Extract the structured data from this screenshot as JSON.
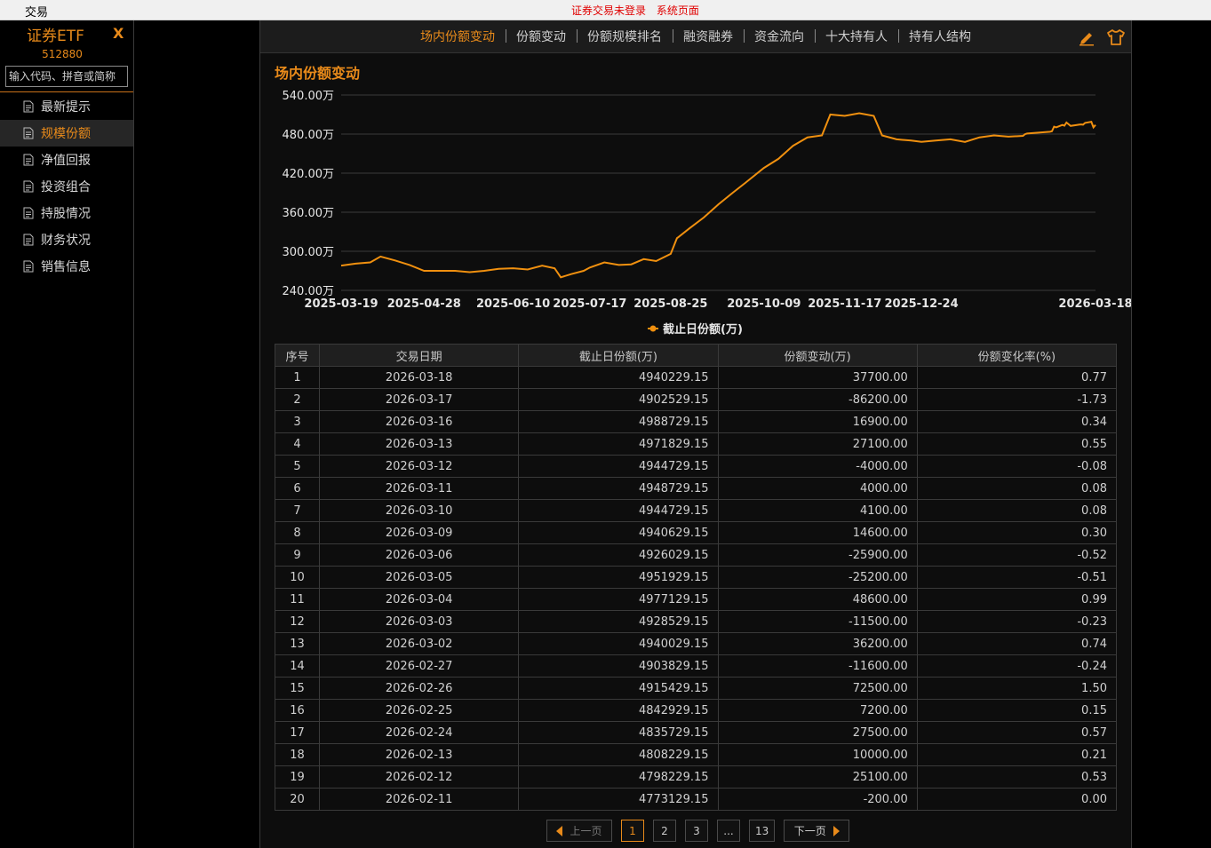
{
  "topbar": {
    "menu": "交易",
    "notice_login": "证券交易未登录",
    "notice_system": "系统页面"
  },
  "sidebar": {
    "title": "证券ETF",
    "close": "X",
    "code": "512880",
    "search_placeholder": "输入代码、拼音或简称",
    "items": [
      {
        "label": "最新提示"
      },
      {
        "label": "规模份额"
      },
      {
        "label": "净值回报"
      },
      {
        "label": "投资组合"
      },
      {
        "label": "持股情况"
      },
      {
        "label": "财务状况"
      },
      {
        "label": "销售信息"
      }
    ],
    "active_index": 1
  },
  "tabs": [
    "场内份额变动",
    "份额变动",
    "份额规模排名",
    "融资融券",
    "资金流向",
    "十大持有人",
    "持有人结构"
  ],
  "active_tab": 0,
  "section_title": "场内份额变动",
  "colors": {
    "accent": "#e88a1a",
    "up": "#ff3b3b",
    "down": "#2fae3d",
    "line": "#f0900f"
  },
  "chart_data": {
    "type": "line",
    "title": "",
    "legend": "截止日份额(万)",
    "legend_position": "bottom",
    "ylim": [
      240,
      540
    ],
    "yticks": [
      "540.00万",
      "480.00万",
      "420.00万",
      "360.00万",
      "300.00万",
      "240.00万"
    ],
    "xticks": [
      "2025-03-19",
      "2025-04-28",
      "2025-06-10",
      "2025-07-17",
      "2025-08-25",
      "2025-10-09",
      "2025-11-17",
      "2025-12-24",
      "2026-03-18"
    ],
    "grid": true,
    "series": [
      {
        "name": "截止日份额(万)",
        "points": [
          [
            "2025-03-19",
            278
          ],
          [
            "2025-03-26",
            281
          ],
          [
            "2025-04-02",
            283
          ],
          [
            "2025-04-07",
            292
          ],
          [
            "2025-04-14",
            286
          ],
          [
            "2025-04-21",
            279
          ],
          [
            "2025-04-28",
            270
          ],
          [
            "2025-05-06",
            270
          ],
          [
            "2025-05-13",
            270
          ],
          [
            "2025-05-20",
            268
          ],
          [
            "2025-05-27",
            270
          ],
          [
            "2025-06-03",
            273
          ],
          [
            "2025-06-10",
            274
          ],
          [
            "2025-06-17",
            272
          ],
          [
            "2025-06-24",
            278
          ],
          [
            "2025-06-30",
            274
          ],
          [
            "2025-07-03",
            260
          ],
          [
            "2025-07-08",
            265
          ],
          [
            "2025-07-14",
            270
          ],
          [
            "2025-07-17",
            275
          ],
          [
            "2025-07-24",
            283
          ],
          [
            "2025-07-31",
            279
          ],
          [
            "2025-08-06",
            280
          ],
          [
            "2025-08-12",
            288
          ],
          [
            "2025-08-18",
            285
          ],
          [
            "2025-08-25",
            296
          ],
          [
            "2025-08-28",
            320
          ],
          [
            "2025-09-03",
            335
          ],
          [
            "2025-09-10",
            352
          ],
          [
            "2025-09-17",
            372
          ],
          [
            "2025-09-24",
            390
          ],
          [
            "2025-09-30",
            405
          ],
          [
            "2025-10-09",
            428
          ],
          [
            "2025-10-16",
            442
          ],
          [
            "2025-10-23",
            462
          ],
          [
            "2025-10-30",
            475
          ],
          [
            "2025-11-06",
            478
          ],
          [
            "2025-11-10",
            510
          ],
          [
            "2025-11-17",
            508
          ],
          [
            "2025-11-24",
            512
          ],
          [
            "2025-12-01",
            508
          ],
          [
            "2025-12-05",
            478
          ],
          [
            "2025-12-12",
            472
          ],
          [
            "2025-12-19",
            470
          ],
          [
            "2025-12-24",
            468
          ],
          [
            "2025-12-31",
            470
          ],
          [
            "2026-01-07",
            472
          ],
          [
            "2026-01-14",
            468
          ],
          [
            "2026-01-21",
            475
          ],
          [
            "2026-01-28",
            478
          ],
          [
            "2026-02-04",
            476
          ],
          [
            "2026-02-11",
            477.3
          ],
          [
            "2026-02-12",
            479.8
          ],
          [
            "2026-02-13",
            480.8
          ],
          [
            "2026-02-24",
            483.6
          ],
          [
            "2026-02-25",
            484.3
          ],
          [
            "2026-02-26",
            491.5
          ],
          [
            "2026-02-27",
            490.4
          ],
          [
            "2026-03-02",
            494.0
          ],
          [
            "2026-03-03",
            492.9
          ],
          [
            "2026-03-04",
            497.7
          ],
          [
            "2026-03-05",
            495.2
          ],
          [
            "2026-03-06",
            492.6
          ],
          [
            "2026-03-09",
            494.1
          ],
          [
            "2026-03-10",
            494.5
          ],
          [
            "2026-03-11",
            494.9
          ],
          [
            "2026-03-12",
            494.5
          ],
          [
            "2026-03-13",
            497.2
          ],
          [
            "2026-03-16",
            498.9
          ],
          [
            "2026-03-17",
            490.3
          ],
          [
            "2026-03-18",
            494.0
          ]
        ]
      }
    ]
  },
  "table": {
    "headers": [
      "序号",
      "交易日期",
      "截止日份额(万)",
      "份额变动(万)",
      "份额变化率(%)"
    ],
    "rows": [
      [
        "1",
        "2026-03-18",
        "4940229.15",
        "37700.00",
        "0.77"
      ],
      [
        "2",
        "2026-03-17",
        "4902529.15",
        "-86200.00",
        "-1.73"
      ],
      [
        "3",
        "2026-03-16",
        "4988729.15",
        "16900.00",
        "0.34"
      ],
      [
        "4",
        "2026-03-13",
        "4971829.15",
        "27100.00",
        "0.55"
      ],
      [
        "5",
        "2026-03-12",
        "4944729.15",
        "-4000.00",
        "-0.08"
      ],
      [
        "6",
        "2026-03-11",
        "4948729.15",
        "4000.00",
        "0.08"
      ],
      [
        "7",
        "2026-03-10",
        "4944729.15",
        "4100.00",
        "0.08"
      ],
      [
        "8",
        "2026-03-09",
        "4940629.15",
        "14600.00",
        "0.30"
      ],
      [
        "9",
        "2026-03-06",
        "4926029.15",
        "-25900.00",
        "-0.52"
      ],
      [
        "10",
        "2026-03-05",
        "4951929.15",
        "-25200.00",
        "-0.51"
      ],
      [
        "11",
        "2026-03-04",
        "4977129.15",
        "48600.00",
        "0.99"
      ],
      [
        "12",
        "2026-03-03",
        "4928529.15",
        "-11500.00",
        "-0.23"
      ],
      [
        "13",
        "2026-03-02",
        "4940029.15",
        "36200.00",
        "0.74"
      ],
      [
        "14",
        "2026-02-27",
        "4903829.15",
        "-11600.00",
        "-0.24"
      ],
      [
        "15",
        "2026-02-26",
        "4915429.15",
        "72500.00",
        "1.50"
      ],
      [
        "16",
        "2026-02-25",
        "4842929.15",
        "7200.00",
        "0.15"
      ],
      [
        "17",
        "2026-02-24",
        "4835729.15",
        "27500.00",
        "0.57"
      ],
      [
        "18",
        "2026-02-13",
        "4808229.15",
        "10000.00",
        "0.21"
      ],
      [
        "19",
        "2026-02-12",
        "4798229.15",
        "25100.00",
        "0.53"
      ],
      [
        "20",
        "2026-02-11",
        "4773129.15",
        "-200.00",
        "0.00"
      ]
    ]
  },
  "pager": {
    "prev": "上一页",
    "next": "下一页",
    "pages": [
      "1",
      "2",
      "3",
      "...",
      "13"
    ],
    "current": "1"
  }
}
